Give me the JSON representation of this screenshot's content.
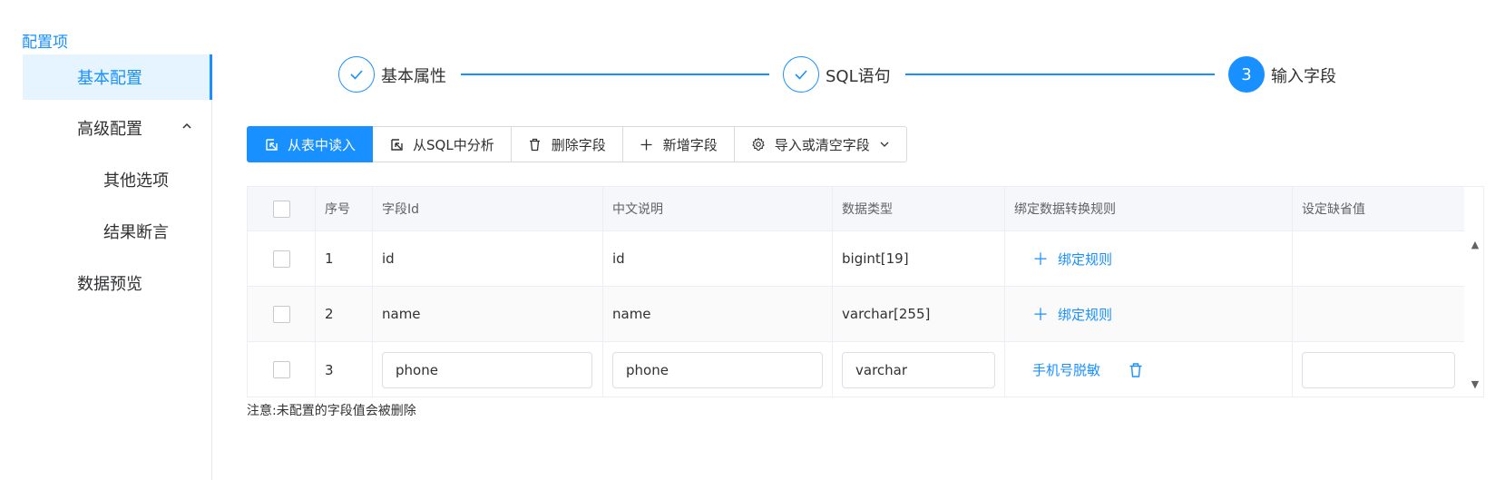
{
  "sidebar": {
    "title": "配置项",
    "items": [
      {
        "label": "基本配置"
      },
      {
        "label": "高级配置"
      },
      {
        "label": "其他选项"
      },
      {
        "label": "结果断言"
      },
      {
        "label": "数据预览"
      }
    ]
  },
  "steps": [
    {
      "label": "基本属性",
      "state": "done"
    },
    {
      "label": "SQL语句",
      "state": "done"
    },
    {
      "label": "输入字段",
      "state": "current",
      "number": "3"
    }
  ],
  "toolbar": {
    "read_from_table": "从表中读入",
    "analyze_sql": "从SQL中分析",
    "delete_field": "删除字段",
    "add_field": "新增字段",
    "import_or_clear": "导入或清空字段"
  },
  "table": {
    "headers": [
      "序号",
      "字段Id",
      "中文说明",
      "数据类型",
      "绑定数据转换规则",
      "设定缺省值"
    ],
    "rows": [
      {
        "index": "1",
        "field_id": "id",
        "desc": "id",
        "type": "bigint[19]",
        "rule": "绑定规则",
        "default": ""
      },
      {
        "index": "2",
        "field_id": "name",
        "desc": "name",
        "type": "varchar[255]",
        "rule": "绑定规则",
        "default": ""
      },
      {
        "index": "3",
        "field_id": "phone",
        "desc": "phone",
        "type": "varchar",
        "rule": "手机号脱敏",
        "default": ""
      }
    ]
  },
  "note": "注意:未配置的字段值会被删除",
  "colors": {
    "accent": "#1890ff"
  }
}
